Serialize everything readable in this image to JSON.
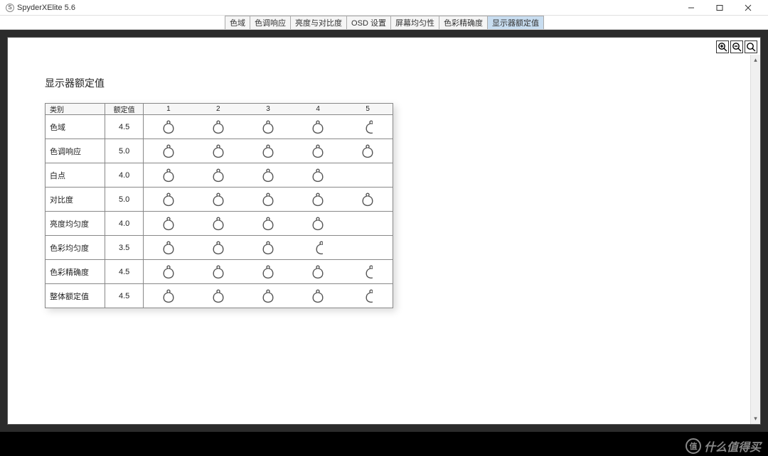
{
  "window": {
    "title": "SpyderXElite 5.6",
    "icon_letter": "S"
  },
  "tabs": [
    {
      "label": "色域"
    },
    {
      "label": "色调响应"
    },
    {
      "label": "亮度与对比度"
    },
    {
      "label": "OSD 设置"
    },
    {
      "label": "屏幕均匀性"
    },
    {
      "label": "色彩精确度"
    },
    {
      "label": "显示器额定值",
      "active": true
    }
  ],
  "report": {
    "title": "显示器额定值",
    "headers": {
      "category": "类别",
      "rating": "额定值",
      "nums": [
        "1",
        "2",
        "3",
        "4",
        "5"
      ]
    },
    "rows": [
      {
        "category": "色域",
        "rating": "4.5",
        "value": 4.5
      },
      {
        "category": "色调响应",
        "rating": "5.0",
        "value": 5.0
      },
      {
        "category": "白点",
        "rating": "4.0",
        "value": 4.0
      },
      {
        "category": "对比度",
        "rating": "5.0",
        "value": 5.0
      },
      {
        "category": "亮度均匀度",
        "rating": "4.0",
        "value": 4.0
      },
      {
        "category": "色彩均匀度",
        "rating": "3.5",
        "value": 3.5
      },
      {
        "category": "色彩精确度",
        "rating": "4.5",
        "value": 4.5
      },
      {
        "category": "整体额定值",
        "rating": "4.5",
        "value": 4.5
      }
    ]
  },
  "watermark": {
    "badge": "值",
    "text": "什么值得买"
  }
}
